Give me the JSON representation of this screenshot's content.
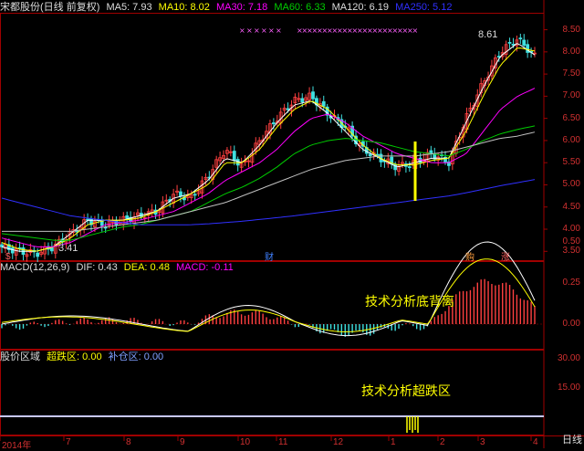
{
  "price_legend": {
    "stock": "宋都股份(日线 前复权)",
    "ma5": "MA5: 7.93",
    "ma10": "MA10: 8.02",
    "ma30": "MA30: 7.18",
    "ma60": "MA60: 6.33",
    "ma120": "MA120: 6.19",
    "ma250": "MA250: 5.12"
  },
  "macd_legend": {
    "title": "MACD(12,26,9)",
    "dif": "DIF: 0.43",
    "dea": "DEA: 0.48",
    "macd": "MACD: -0.11"
  },
  "zone_legend": {
    "title": "股价区域",
    "over": "超跌区: 0.00",
    "add": "补仓区: 0.00"
  },
  "annotations": {
    "divergence": "技术分析底背离",
    "oversold": "技术分析超跌区",
    "high_label": "8.61",
    "low_label": "3.41"
  },
  "price_axis": [
    "8.50",
    "8.00",
    "7.50",
    "7.00",
    "6.50",
    "6.00",
    "5.50",
    "5.00",
    "4.50",
    "4.00",
    "3.50"
  ],
  "macd_axis": [
    "0.50",
    "0.25",
    "0.00"
  ],
  "zone_axis": [
    "30.00",
    "15.00"
  ],
  "x_labels": [
    "2014年",
    "7",
    "8",
    "9",
    "10",
    "11",
    "12",
    "1",
    "2",
    "3",
    "4"
  ],
  "markers": {
    "cai": "财",
    "gou": "购",
    "zhang": "涨",
    "s": "$"
  },
  "tab": "日线",
  "colors": {
    "ma5": "#ffffff",
    "ma10": "#ffff00",
    "ma30": "#ff00ff",
    "ma60": "#00cc00",
    "ma120": "#c0c0c0",
    "ma250": "#3030ff",
    "up": "#ff4040",
    "down": "#40e0e0"
  },
  "chart_data": {
    "type": "candlestick",
    "title": "宋都股份(日线 前复权)",
    "x": [
      "2014年",
      "7",
      "8",
      "9",
      "10",
      "11",
      "12",
      "1",
      "2",
      "3",
      "4"
    ],
    "ylim": [
      3.3,
      8.8
    ],
    "close_approx": [
      3.6,
      3.5,
      3.45,
      3.6,
      3.9,
      4.2,
      4.1,
      4.2,
      4.3,
      4.4,
      4.8,
      4.7,
      5.2,
      5.8,
      5.4,
      6.0,
      6.5,
      6.9,
      7.0,
      6.6,
      6.3,
      5.8,
      5.6,
      5.4,
      5.5,
      5.7,
      5.5,
      6.5,
      7.3,
      8.0,
      8.3,
      7.9
    ],
    "series": [
      {
        "name": "MA5",
        "values": [
          3.6,
          3.5,
          3.5,
          3.6,
          3.9,
          4.2,
          4.2,
          4.2,
          4.3,
          4.4,
          4.7,
          4.8,
          5.1,
          5.6,
          5.5,
          5.9,
          6.4,
          6.8,
          6.9,
          6.6,
          6.2,
          5.8,
          5.6,
          5.4,
          5.5,
          5.6,
          5.6,
          6.4,
          7.2,
          7.9,
          8.2,
          7.93
        ]
      },
      {
        "name": "MA10",
        "values": [
          3.7,
          3.55,
          3.5,
          3.6,
          3.8,
          4.1,
          4.2,
          4.2,
          4.25,
          4.4,
          4.6,
          4.8,
          5.0,
          5.5,
          5.5,
          5.8,
          6.3,
          6.7,
          6.9,
          6.7,
          6.3,
          5.9,
          5.6,
          5.45,
          5.45,
          5.55,
          5.6,
          6.2,
          7.0,
          7.7,
          8.1,
          8.02
        ]
      },
      {
        "name": "MA30",
        "values": [
          3.8,
          3.7,
          3.6,
          3.6,
          3.7,
          3.9,
          4.1,
          4.15,
          4.2,
          4.3,
          4.4,
          4.6,
          4.8,
          5.1,
          5.3,
          5.5,
          5.8,
          6.2,
          6.5,
          6.6,
          6.4,
          6.1,
          5.9,
          5.7,
          5.6,
          5.5,
          5.5,
          5.7,
          6.2,
          6.7,
          7.0,
          7.18
        ]
      },
      {
        "name": "MA60",
        "values": [
          3.9,
          3.85,
          3.8,
          3.75,
          3.75,
          3.85,
          3.95,
          4.05,
          4.1,
          4.2,
          4.3,
          4.4,
          4.6,
          4.8,
          4.95,
          5.15,
          5.4,
          5.7,
          5.9,
          6.0,
          6.05,
          6.0,
          5.95,
          5.85,
          5.75,
          5.7,
          5.65,
          5.8,
          6.0,
          6.15,
          6.25,
          6.33
        ]
      },
      {
        "name": "MA120",
        "values": [
          3.95,
          3.95,
          3.95,
          3.95,
          3.95,
          4.0,
          4.05,
          4.1,
          4.15,
          4.2,
          4.3,
          4.4,
          4.5,
          4.6,
          4.75,
          4.9,
          5.05,
          5.2,
          5.35,
          5.45,
          5.55,
          5.6,
          5.65,
          5.65,
          5.65,
          5.7,
          5.75,
          5.85,
          5.95,
          6.05,
          6.1,
          6.19
        ]
      },
      {
        "name": "MA250",
        "values": [
          4.7,
          4.6,
          4.5,
          4.4,
          4.3,
          4.25,
          4.2,
          4.15,
          4.1,
          4.1,
          4.1,
          4.1,
          4.12,
          4.15,
          4.18,
          4.22,
          4.26,
          4.3,
          4.35,
          4.4,
          4.45,
          4.5,
          4.55,
          4.6,
          4.65,
          4.7,
          4.75,
          4.82,
          4.9,
          4.98,
          5.05,
          5.12
        ]
      }
    ]
  }
}
